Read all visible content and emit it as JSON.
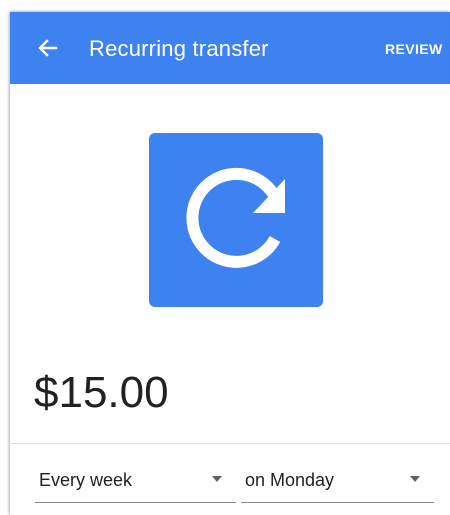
{
  "appbar": {
    "title": "Recurring transfer",
    "action_label": "REVIEW",
    "color": "#3e82f2",
    "back_icon": "arrow-back-icon"
  },
  "hero": {
    "icon": "recurring-refresh-icon",
    "color": "#3e82f2"
  },
  "transfer": {
    "amount": "$15.00"
  },
  "schedule": {
    "frequency": {
      "selected": "Every week"
    },
    "day": {
      "selected": "on Monday"
    }
  }
}
